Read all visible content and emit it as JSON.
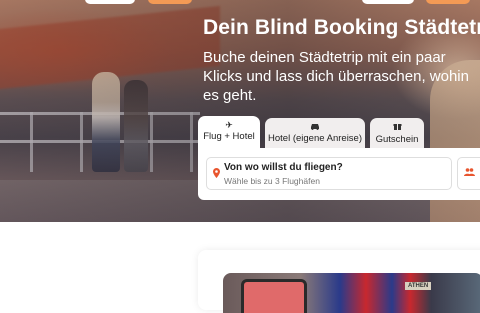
{
  "hero": {
    "title": "Dein Blind Booking Städtetrip",
    "subtitle": "Buche deinen Städtetrip mit ein paar Klicks und lass dich überraschen, wohin es geht."
  },
  "search": {
    "tabs": [
      {
        "label": "Flug + Hotel",
        "icon": "airplane-icon",
        "active": true
      },
      {
        "label": "Hotel (eigene Anreise)",
        "icon": "car-icon",
        "active": false
      },
      {
        "label": "Gutschein",
        "icon": "gift-icon",
        "active": false
      }
    ],
    "origin_label": "Von wo willst du fliegen?",
    "origin_placeholder": "Wähle bis zu 3 Flughäfen"
  },
  "card": {
    "sign_text": "ATHEN"
  },
  "colors": {
    "accent": "#e8552e",
    "tab_bg": "#f1eeee"
  }
}
